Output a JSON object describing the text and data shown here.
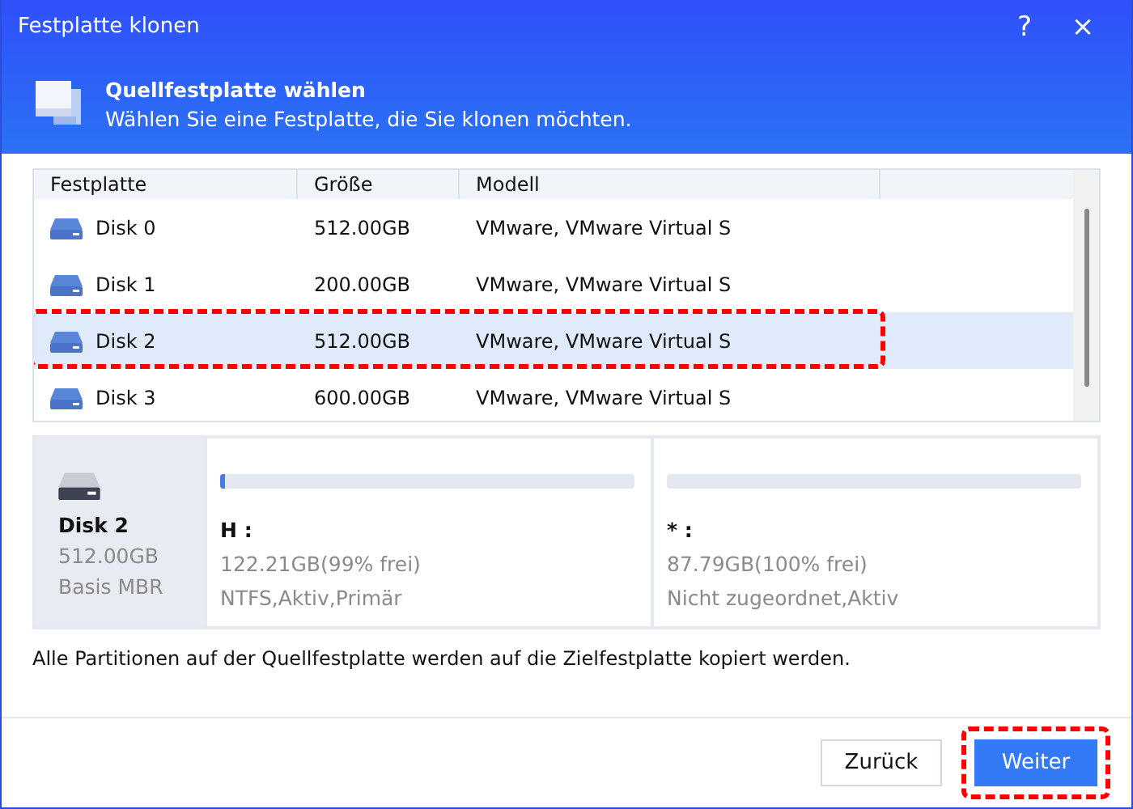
{
  "window": {
    "title": "Festplatte klonen",
    "help": "?",
    "close": "×"
  },
  "header": {
    "title": "Quellfestplatte wählen",
    "subtitle": "Wählen Sie eine Festplatte, die Sie klonen möchten."
  },
  "table": {
    "columns": [
      "Festplatte",
      "Größe",
      "Modell"
    ],
    "rows": [
      {
        "disk": "Disk 0",
        "size": "512.00GB",
        "model": "VMware, VMware Virtual S",
        "selected": false,
        "highlighted": false
      },
      {
        "disk": "Disk 1",
        "size": "200.00GB",
        "model": "VMware, VMware Virtual S",
        "selected": false,
        "highlighted": false
      },
      {
        "disk": "Disk 2",
        "size": "512.00GB",
        "model": "VMware, VMware Virtual S",
        "selected": true,
        "highlighted": true
      },
      {
        "disk": "Disk 3",
        "size": "600.00GB",
        "model": "VMware, VMware Virtual S",
        "selected": false,
        "highlighted": false
      }
    ]
  },
  "disk_info": {
    "name": "Disk 2",
    "size": "512.00GB",
    "type": "Basis MBR",
    "partitions": [
      {
        "label": "H :",
        "capacity": "122.21GB(99% frei)",
        "details": "NTFS,Aktiv,Primär",
        "level": 0.01
      },
      {
        "label": "* :",
        "capacity": "87.79GB(100% frei)",
        "details": "Nicht zugeordnet,Aktiv",
        "level": 0
      }
    ]
  },
  "note": "Alle Partitionen auf der Quellfestplatte werden auf die Zielfestplatte kopiert werden.",
  "buttons": [
    {
      "label": "Zurück",
      "kind": "secondary",
      "highlighted": false
    },
    {
      "label": "Weiter",
      "kind": "primary",
      "highlighted": true
    }
  ]
}
